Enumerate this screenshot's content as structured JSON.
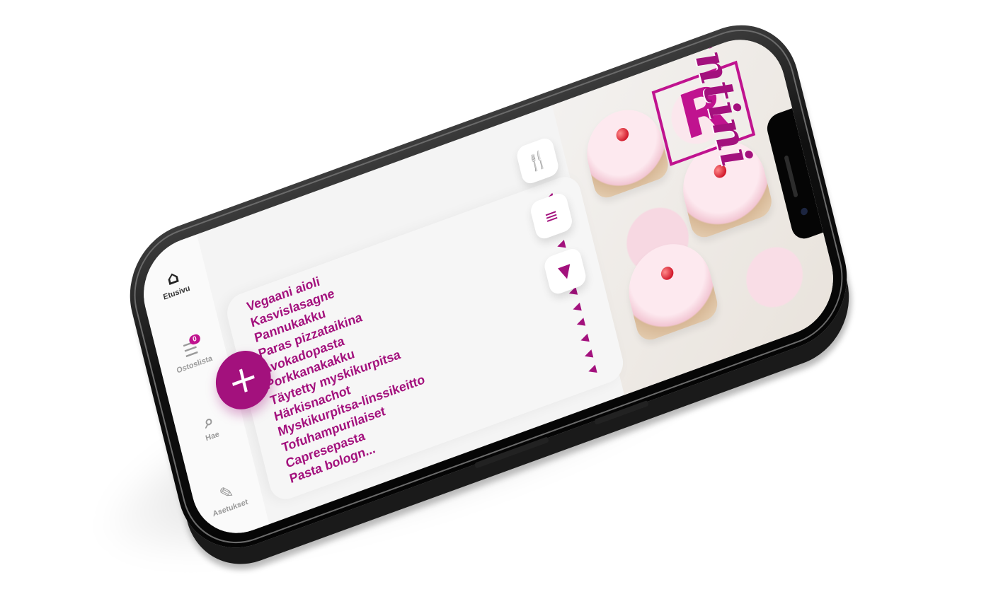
{
  "app": {
    "name": "Resentini",
    "logo_letter": "R",
    "accent_color": "#a3117d"
  },
  "categories": [
    {
      "icon": "fork-knife-icon",
      "glyph": "🍴"
    },
    {
      "icon": "burger-icon",
      "glyph": "≡"
    },
    {
      "icon": "ice-cream-icon",
      "glyph": "▼"
    }
  ],
  "recipes": [
    "Vegaani aioli",
    "Kasvislasagne",
    "Pannukakku",
    "Paras pizzataikina",
    "Avokadopasta",
    "Porkkanakakku",
    "Täytetty myskikurpitsa",
    "Härkisnachot",
    "Myskikurpitsa-linssikeitto",
    "Tofuhampurilaiset",
    "Capresepasta",
    "Pasta bologn..."
  ],
  "tabbar": {
    "home": "Etusivu",
    "shopping_list": "Ostoslista",
    "shopping_badge": "0",
    "search": "Hae",
    "settings": "Asetukset"
  },
  "fab_label": "+"
}
